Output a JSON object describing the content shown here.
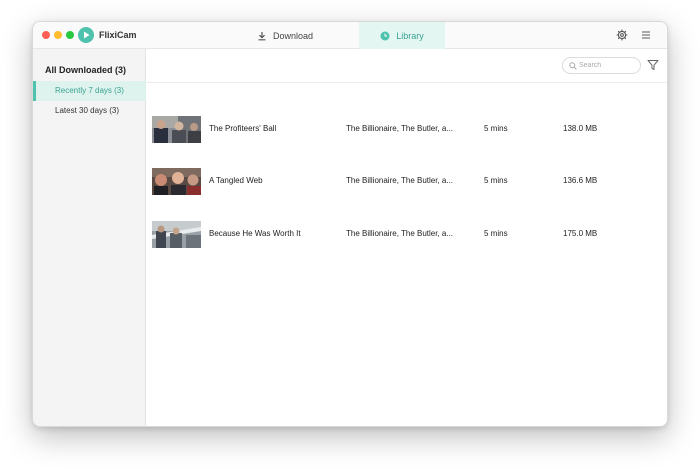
{
  "app": {
    "name": "FlixiCam"
  },
  "tabs": {
    "download": "Download",
    "library": "Library"
  },
  "sidebar": {
    "heading": "All Downloaded (3)",
    "items": [
      {
        "label": "Recently 7 days (3)",
        "active": true
      },
      {
        "label": "Latest 30 days (3)",
        "active": false
      }
    ]
  },
  "toolbar": {
    "search_placeholder": "Search"
  },
  "videos": [
    {
      "title": "The Profiteers' Ball",
      "cast": "The Billionaire, The Butler, a...",
      "duration": "5 mins",
      "size": "138.0 MB"
    },
    {
      "title": "A Tangled Web",
      "cast": "The Billionaire, The Butler, a...",
      "duration": "5 mins",
      "size": "136.6 MB"
    },
    {
      "title": "Because He Was Worth It",
      "cast": "The Billionaire, The Butler, a...",
      "duration": "5 mins",
      "size": "175.0 MB"
    }
  ],
  "colors": {
    "accent": "#4fc2ad",
    "accent_text": "#3aa391",
    "active_bg": "#def3ee"
  }
}
